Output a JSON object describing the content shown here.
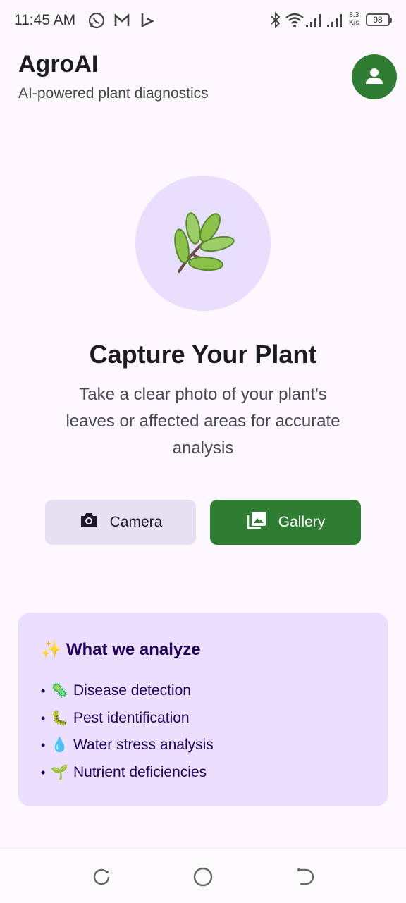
{
  "status_bar": {
    "time": "11:45 AM",
    "net_speed_value": "8.3",
    "net_speed_unit": "K/s",
    "battery": "98",
    "icons": [
      "whatsapp-icon",
      "gmail-icon",
      "bing-icon",
      "bluetooth-icon",
      "wifi-icon",
      "signal-icon",
      "signal-icon"
    ]
  },
  "header": {
    "title": "AgroAI",
    "subtitle": "AI-powered plant diagnostics",
    "profile_icon": "person-icon"
  },
  "hero": {
    "icon": "🌿",
    "title": "Capture Your Plant",
    "description": "Take a clear photo of your plant's leaves or affected areas for accurate analysis"
  },
  "actions": {
    "camera_label": "Camera",
    "gallery_label": "Gallery"
  },
  "analyze": {
    "title_icon": "✨",
    "title": "What we analyze",
    "items": [
      {
        "icon": "🦠",
        "label": "Disease detection"
      },
      {
        "icon": "🐛",
        "label": "Pest identification"
      },
      {
        "icon": "💧",
        "label": "Water stress analysis"
      },
      {
        "icon": "🌱",
        "label": "Nutrient deficiencies"
      }
    ]
  },
  "colors": {
    "primary": "#2e7d32",
    "hero_circle": "#e8defd",
    "card_bg": "#ebdeff",
    "secondary_button": "#e6e0f3"
  }
}
